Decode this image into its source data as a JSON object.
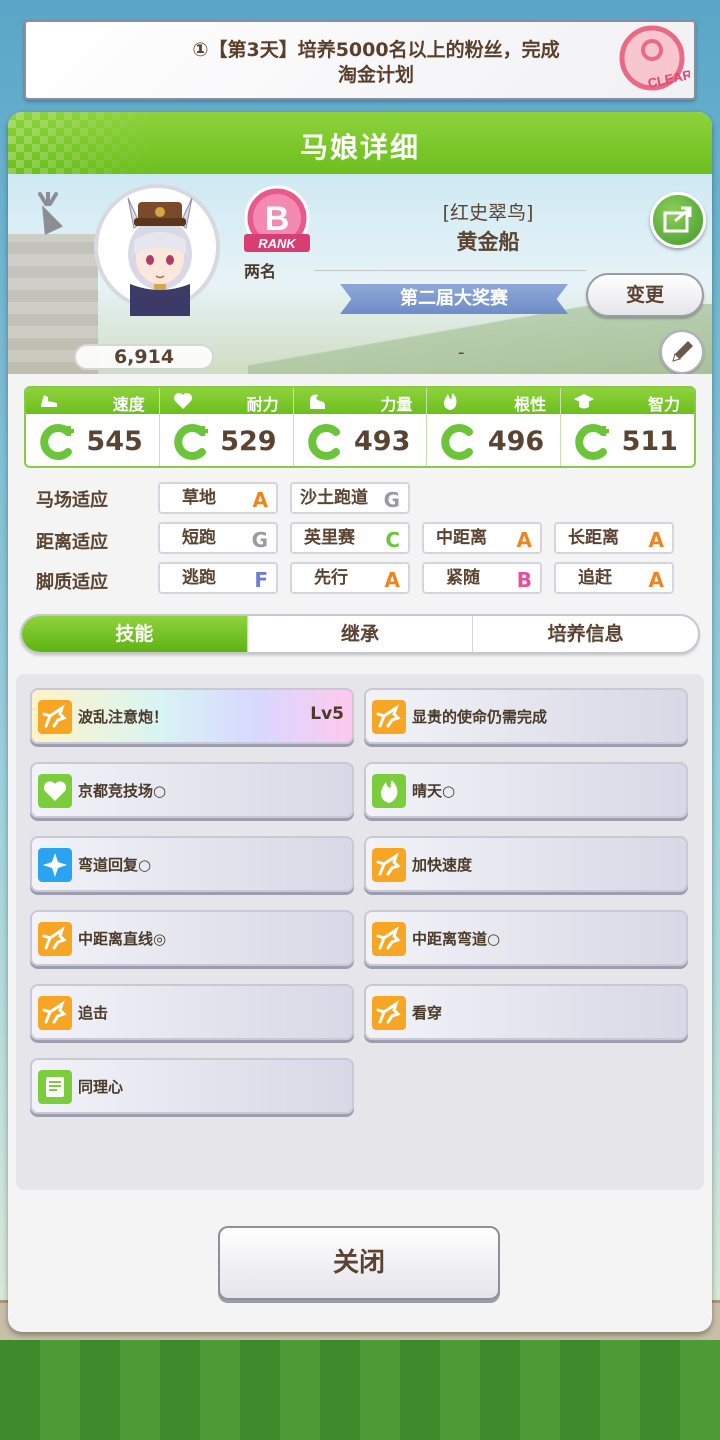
{
  "mission": {
    "text_line1": "①【第3天】培养5000名以上的粉丝，完成",
    "text_line2": "淘金计划",
    "badge": "CLEAR!"
  },
  "dialog": {
    "title": "马娘详细"
  },
  "profile": {
    "fans": "6,914",
    "rank_letter": "B",
    "rank_word": "RANK",
    "rank_sub": "两名",
    "epithet": "[红史翠鸟]",
    "name": "黄金船",
    "title_ribbon": "第二届大奖赛",
    "change_label": "变更",
    "dash": "-"
  },
  "stats": [
    {
      "label": "速度",
      "grade": "C+",
      "value": "545",
      "icon": "shoe-icon"
    },
    {
      "label": "耐力",
      "grade": "C+",
      "value": "529",
      "icon": "heart-icon"
    },
    {
      "label": "力量",
      "grade": "C",
      "value": "493",
      "icon": "muscle-icon"
    },
    {
      "label": "根性",
      "grade": "C",
      "value": "496",
      "icon": "flame-icon"
    },
    {
      "label": "智力",
      "grade": "C+",
      "value": "511",
      "icon": "graduation-cap-icon"
    }
  ],
  "aptitude": {
    "track_label": "马场适应",
    "distance_label": "距离适应",
    "style_label": "脚质适应",
    "track": [
      {
        "name": "草地",
        "grade": "A"
      },
      {
        "name": "沙土跑道",
        "grade": "G"
      }
    ],
    "distance": [
      {
        "name": "短跑",
        "grade": "G"
      },
      {
        "name": "英里赛",
        "grade": "C"
      },
      {
        "name": "中距离",
        "grade": "A"
      },
      {
        "name": "长距离",
        "grade": "A"
      }
    ],
    "style": [
      {
        "name": "逃跑",
        "grade": "F"
      },
      {
        "name": "先行",
        "grade": "A"
      },
      {
        "name": "紧随",
        "grade": "B"
      },
      {
        "name": "追赶",
        "grade": "A"
      }
    ]
  },
  "tabs": [
    "技能",
    "继承",
    "培养信息"
  ],
  "skills": [
    {
      "name": "波乱注意炮！",
      "level": "Lv5",
      "icon": "running-horse-icon",
      "color": "#f6a623"
    },
    {
      "name": "显贵的使命仍需完成",
      "level": "",
      "icon": "running-horse-icon",
      "color": "#f6a623"
    },
    {
      "name": "京都竞技场○",
      "level": "",
      "icon": "heart-icon",
      "color": "#7ccd3c"
    },
    {
      "name": "晴天○",
      "level": "",
      "icon": "flame-icon",
      "color": "#7ccd3c"
    },
    {
      "name": "弯道回复○",
      "level": "",
      "icon": "sparkle-icon",
      "color": "#2aa3f0"
    },
    {
      "name": "加快速度",
      "level": "",
      "icon": "running-horse-icon",
      "color": "#f6a623"
    },
    {
      "name": "中距离直线◎",
      "level": "",
      "icon": "running-horse-icon",
      "color": "#f6a623"
    },
    {
      "name": "中距离弯道○",
      "level": "",
      "icon": "running-horse-icon",
      "color": "#f6a623"
    },
    {
      "name": "追击",
      "level": "",
      "icon": "running-horse-icon",
      "color": "#f6a623"
    },
    {
      "name": "看穿",
      "level": "",
      "icon": "running-horse-icon",
      "color": "#f6a623"
    },
    {
      "name": "同理心",
      "level": "",
      "icon": "book-icon",
      "color": "#7ccd3c"
    }
  ],
  "close_label": "关闭",
  "colors": {
    "header_green": "#7cc82a",
    "grade_A": "#f0841e",
    "grade_B": "#e84f9a",
    "grade_C": "#6cc43a",
    "grade_F": "#6b7de0",
    "grade_G": "#9a9aa4"
  }
}
